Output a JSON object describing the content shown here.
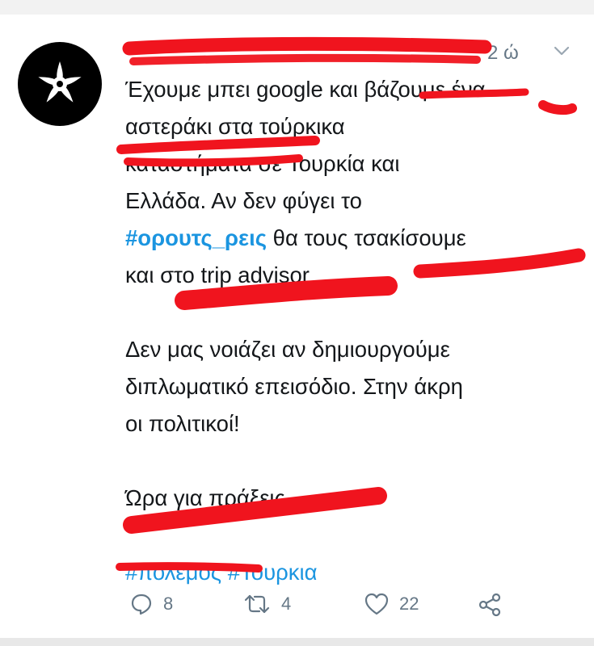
{
  "tweet": {
    "time": "2 ώ",
    "lines": [
      "Έχουμε μπει google και βάζουμε ένα",
      "αστεράκι στα τούρκικα",
      "καταστήματα σε Τουρκία και",
      "Ελλάδα. Αν δεν φύγει το",
      "θα τους τσακίσουμε",
      "και στο trip advisor",
      "Δεν μας νοιάζει αν δημιουργούμε",
      "διπλωματικό επεισόδιο. Στην άκρη",
      "οι πολιτικοί!",
      "Ώρα για πράξεις..."
    ],
    "hashtag_inline": "#ορουτς_ρεις",
    "hashtags": [
      "#πολεμος",
      "#Τουρκια"
    ]
  },
  "actions": {
    "replies": "8",
    "retweets": "4",
    "likes": "22"
  },
  "colors": {
    "text": "#14171a",
    "hashtag": "#1b95e0",
    "muted": "#657786",
    "redaction": "#f0141e"
  }
}
